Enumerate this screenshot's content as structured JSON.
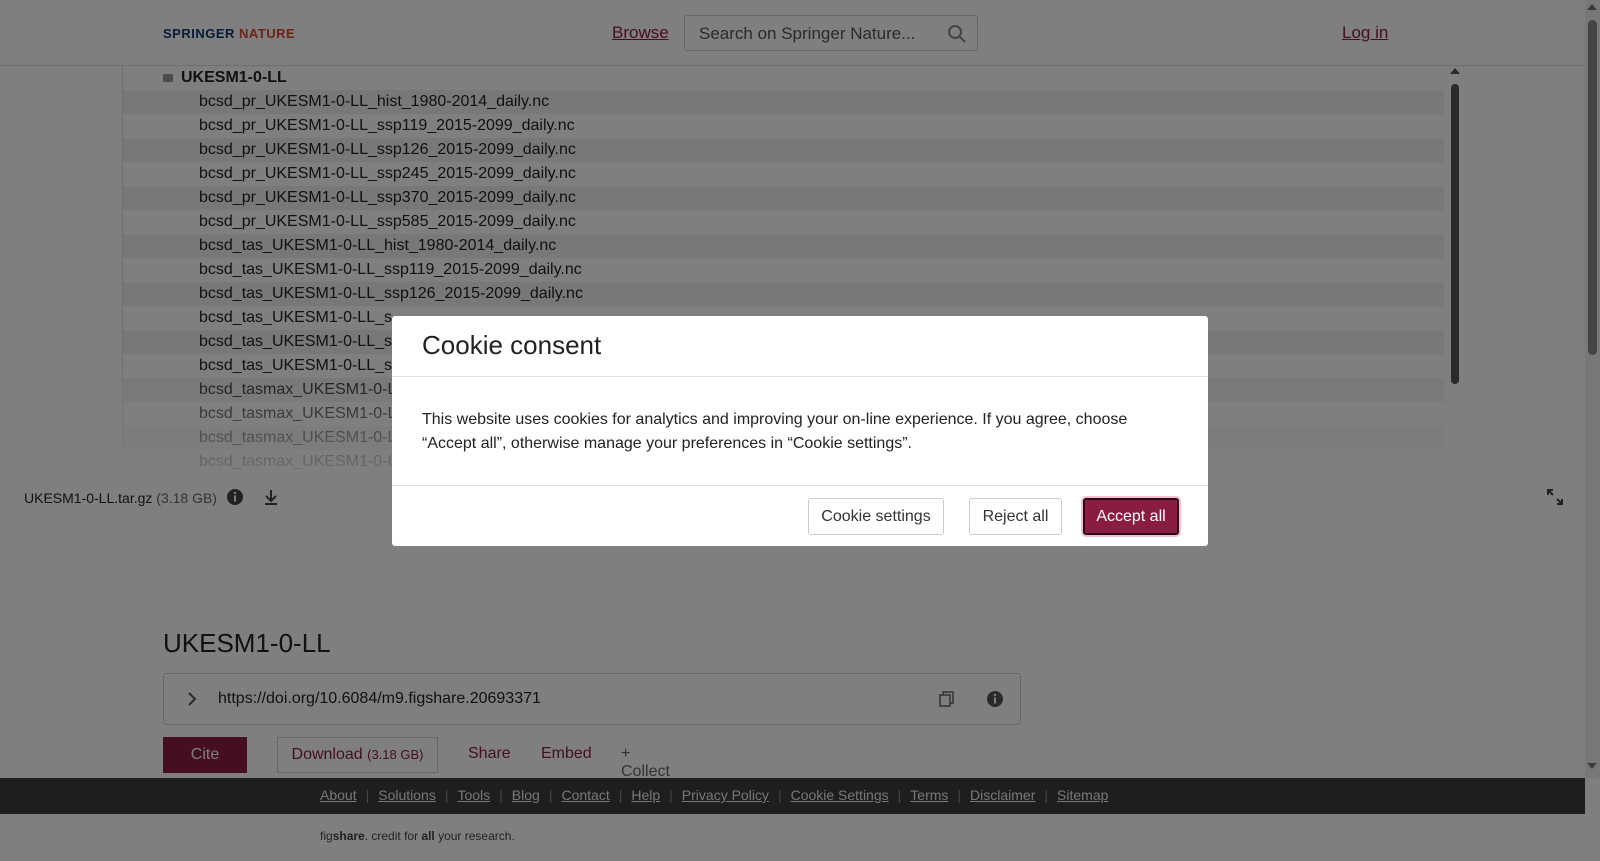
{
  "header": {
    "logo_part1": "SPRINGER",
    "logo_part2": "NATURE",
    "browse": "Browse",
    "search_placeholder": "Search on Springer Nature...",
    "login": "Log in"
  },
  "tree": {
    "folder": "UKESM1-0-LL",
    "files": [
      "bcsd_pr_UKESM1-0-LL_hist_1980-2014_daily.nc",
      "bcsd_pr_UKESM1-0-LL_ssp119_2015-2099_daily.nc",
      "bcsd_pr_UKESM1-0-LL_ssp126_2015-2099_daily.nc",
      "bcsd_pr_UKESM1-0-LL_ssp245_2015-2099_daily.nc",
      "bcsd_pr_UKESM1-0-LL_ssp370_2015-2099_daily.nc",
      "bcsd_pr_UKESM1-0-LL_ssp585_2015-2099_daily.nc",
      "bcsd_tas_UKESM1-0-LL_hist_1980-2014_daily.nc",
      "bcsd_tas_UKESM1-0-LL_ssp119_2015-2099_daily.nc",
      "bcsd_tas_UKESM1-0-LL_ssp126_2015-2099_daily.nc",
      "bcsd_tas_UKESM1-0-LL_s",
      "bcsd_tas_UKESM1-0-LL_s",
      "bcsd_tas_UKESM1-0-LL_s",
      "bcsd_tasmax_UKESM1-0-L",
      "bcsd_tasmax_UKESM1-0-L",
      "bcsd_tasmax_UKESM1-0-L",
      "bcsd_tasmax_UKESM1-0-L"
    ]
  },
  "file_bar": {
    "name": "UKESM1-0-LL.tar.gz",
    "size": "(3.18 GB)"
  },
  "item": {
    "title": "UKESM1-0-LL",
    "doi": "https://doi.org/10.6084/m9.figshare.20693371",
    "cite": "Cite",
    "download": "Download",
    "download_size": "(3.18 GB)",
    "share": "Share",
    "embed": "Embed",
    "collect": "+ Collect"
  },
  "footer": {
    "links": [
      "About",
      "Solutions",
      "Tools",
      "Blog",
      "Contact",
      "Help",
      "Privacy Policy",
      "Cookie Settings",
      "Terms",
      "Disclaimer",
      "Sitemap"
    ],
    "tagline_1": "fig",
    "tagline_2": "share",
    "tagline_3": ". credit for ",
    "tagline_4": "all",
    "tagline_5": " your research."
  },
  "cookie_modal": {
    "title": "Cookie consent",
    "body": "This website uses cookies for analytics and improving your on-line experience. If you agree, choose “Accept all”, otherwise manage your preferences in “Cookie settings”.",
    "settings_label": "Cookie settings",
    "reject_label": "Reject all",
    "accept_label": "Accept all"
  },
  "colors": {
    "brand": "#8a1c42",
    "footer_bg": "#3c3c3c"
  }
}
